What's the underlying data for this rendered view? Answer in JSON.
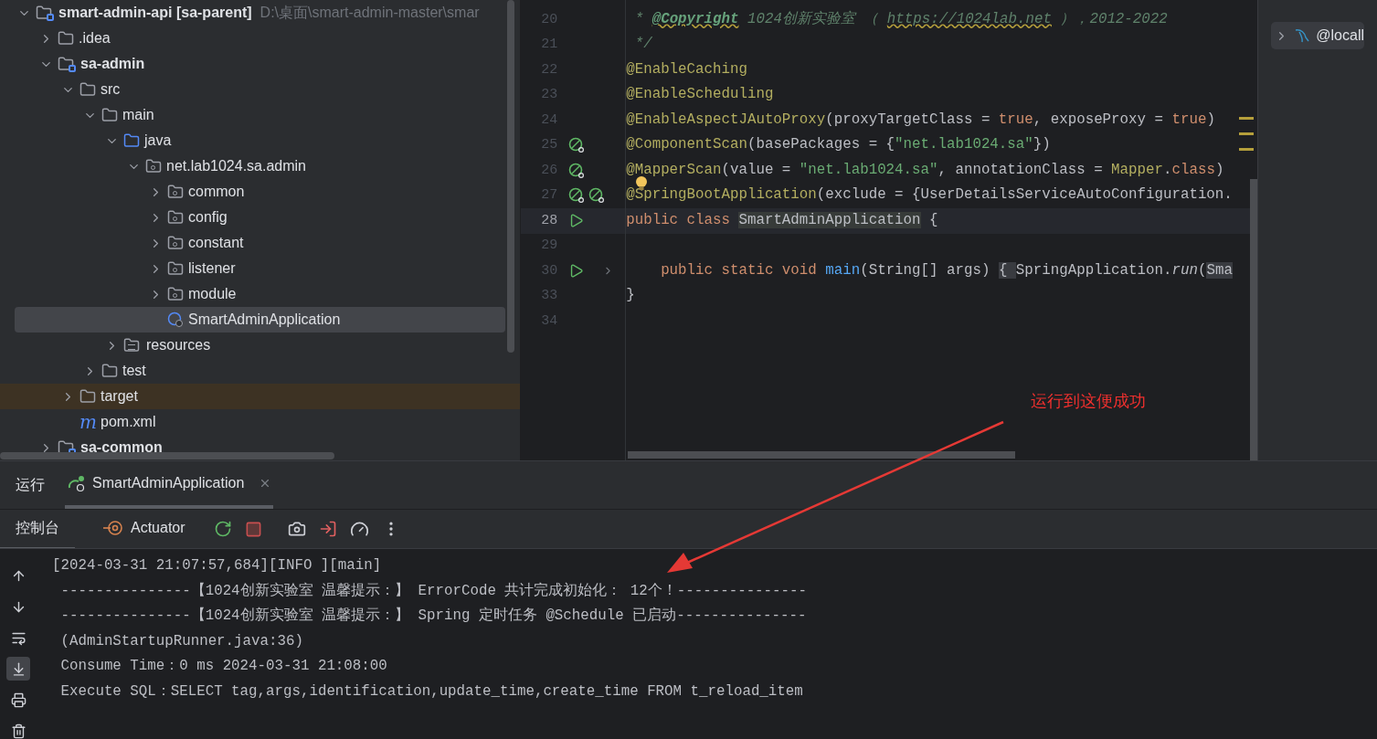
{
  "project_tree": [
    {
      "label": "smart-admin-api [sa-parent]",
      "path": "D:\\桌面\\smart-admin-master\\smar",
      "kind": "module",
      "expanded": true,
      "selected": false,
      "excluded": false,
      "children": [
        {
          "label": ".idea",
          "kind": "folder",
          "expanded": false,
          "selected": false,
          "excluded": false
        },
        {
          "label": "sa-admin",
          "kind": "module",
          "expanded": true,
          "selected": false,
          "excluded": false,
          "children": [
            {
              "label": "src",
              "kind": "folder",
              "expanded": true,
              "selected": false,
              "excluded": false,
              "children": [
                {
                  "label": "main",
                  "kind": "folder",
                  "expanded": true,
                  "selected": false,
                  "excluded": false,
                  "children": [
                    {
                      "label": "java",
                      "kind": "source",
                      "expanded": true,
                      "selected": false,
                      "excluded": false,
                      "children": [
                        {
                          "label": "net.lab1024.sa.admin",
                          "kind": "package",
                          "expanded": true,
                          "selected": false,
                          "excluded": false,
                          "children": [
                            {
                              "label": "common",
                              "kind": "package",
                              "expanded": false,
                              "selected": false,
                              "excluded": false
                            },
                            {
                              "label": "config",
                              "kind": "package",
                              "expanded": false,
                              "selected": false,
                              "excluded": false
                            },
                            {
                              "label": "constant",
                              "kind": "package",
                              "expanded": false,
                              "selected": false,
                              "excluded": false
                            },
                            {
                              "label": "listener",
                              "kind": "package",
                              "expanded": false,
                              "selected": false,
                              "excluded": false
                            },
                            {
                              "label": "module",
                              "kind": "package",
                              "expanded": false,
                              "selected": false,
                              "excluded": false
                            },
                            {
                              "label": "SmartAdminApplication",
                              "kind": "class",
                              "selected": true,
                              "excluded": false
                            }
                          ]
                        }
                      ]
                    },
                    {
                      "label": "resources",
                      "kind": "resources",
                      "expanded": false,
                      "selected": false,
                      "excluded": false
                    }
                  ]
                },
                {
                  "label": "test",
                  "kind": "folder",
                  "expanded": false,
                  "selected": false,
                  "excluded": false
                }
              ]
            },
            {
              "label": "target",
              "kind": "folder",
              "expanded": false,
              "selected": false,
              "excluded": true
            },
            {
              "label": "pom.xml",
              "kind": "maven",
              "icon_glyph": "m",
              "selected": false,
              "excluded": false
            }
          ]
        },
        {
          "label": "sa-common",
          "kind": "module",
          "expanded": false,
          "selected": false,
          "excluded": false
        }
      ]
    }
  ],
  "editor": {
    "lines": [
      {
        "number": "20",
        "current": false,
        "tokens": [
          {
            "text": " * ",
            "kind": "comment"
          },
          {
            "text": "@Copyright",
            "kind": "doc-tag"
          },
          {
            "text": " 1024创新实验室 （ ",
            "kind": "comment"
          },
          {
            "text": "https://1024lab.net",
            "kind": "doc-link"
          },
          {
            "text": " ），2012-2022",
            "kind": "comment"
          }
        ]
      },
      {
        "number": "21",
        "current": false,
        "tokens": [
          {
            "text": " */",
            "kind": "comment"
          }
        ]
      },
      {
        "number": "22",
        "current": false,
        "tokens": [
          {
            "text": "@EnableCaching",
            "kind": "annotation"
          }
        ]
      },
      {
        "number": "23",
        "current": false,
        "tokens": [
          {
            "text": "@EnableScheduling",
            "kind": "annotation"
          }
        ]
      },
      {
        "number": "24",
        "current": false,
        "tokens": [
          {
            "text": "@EnableAspectJAutoProxy",
            "kind": "annotation"
          },
          {
            "text": "(proxyTargetClass = ",
            "kind": "plain"
          },
          {
            "text": "true",
            "kind": "keyword"
          },
          {
            "text": ", exposeProxy = ",
            "kind": "plain"
          },
          {
            "text": "true",
            "kind": "keyword"
          },
          {
            "text": ")",
            "kind": "plain"
          }
        ]
      },
      {
        "number": "25",
        "current": false,
        "gutter": [
          {
            "kind": "bean"
          }
        ],
        "tokens": [
          {
            "text": "@ComponentScan",
            "kind": "annotation"
          },
          {
            "text": "(basePackages = {",
            "kind": "plain"
          },
          {
            "text": "\"net.lab1024.sa\"",
            "kind": "string"
          },
          {
            "text": "})",
            "kind": "plain"
          }
        ]
      },
      {
        "number": "26",
        "current": false,
        "gutter": [
          {
            "kind": "bean"
          }
        ],
        "tokens": [
          {
            "text": "@MapperScan",
            "kind": "annotation"
          },
          {
            "text": "(value = ",
            "kind": "plain"
          },
          {
            "text": "\"net.lab1024.sa\"",
            "kind": "string"
          },
          {
            "text": ", annotationClass = ",
            "kind": "plain"
          },
          {
            "text": "Mapper",
            "kind": "annotation"
          },
          {
            "text": ".",
            "kind": "plain"
          },
          {
            "text": "class",
            "kind": "keyword"
          },
          {
            "text": ")",
            "kind": "plain"
          }
        ]
      },
      {
        "number": "27",
        "current": false,
        "gutter": [
          {
            "kind": "bean"
          },
          {
            "kind": "bean"
          }
        ],
        "bulb": true,
        "tokens": [
          {
            "text": "@SpringBootApplication",
            "kind": "annotation"
          },
          {
            "text": "(exclude = {UserDetailsServiceAutoConfiguration.",
            "kind": "plain"
          }
        ]
      },
      {
        "number": "28",
        "current": true,
        "gutter": [
          {
            "kind": "run"
          }
        ],
        "tokens": [
          {
            "text": "public class ",
            "kind": "keyword"
          },
          {
            "text": "SmartAdminApplication",
            "kind": "usage"
          },
          {
            "text": " {",
            "kind": "plain"
          }
        ]
      },
      {
        "number": "29",
        "current": false
      },
      {
        "number": "30",
        "current": false,
        "gutter": [
          {
            "kind": "run"
          },
          {
            "kind": "fold"
          }
        ],
        "tokens": [
          {
            "text": "    public static void ",
            "kind": "keyword"
          },
          {
            "text": "main",
            "kind": "method"
          },
          {
            "text": "(String[] args) ",
            "kind": "plain"
          },
          {
            "text": "{ ",
            "kind": "folded"
          },
          {
            "text": "SpringApplication.",
            "kind": "plain"
          },
          {
            "text": "run",
            "kind": "static"
          },
          {
            "text": "(",
            "kind": "plain"
          },
          {
            "text": "Sma",
            "kind": "folded"
          }
        ]
      },
      {
        "number": "33",
        "current": false,
        "tokens": [
          {
            "text": "}",
            "kind": "plain"
          }
        ]
      },
      {
        "number": "34",
        "current": false
      }
    ]
  },
  "database_panel": {
    "items": [
      {
        "label": "@locall",
        "expanded": false
      }
    ]
  },
  "annotation": {
    "text": "运行到这便成功"
  },
  "run_panel": {
    "title": "运行",
    "tabs": [
      {
        "label": "SmartAdminApplication",
        "selected": true
      }
    ],
    "toolbar": {
      "tabs": [
        {
          "label": "控制台",
          "kind": "console",
          "selected": true
        },
        {
          "label": "Actuator",
          "kind": "actuator",
          "selected": false
        }
      ],
      "actions": [
        {
          "kind": "rerun"
        },
        {
          "kind": "stop"
        },
        {
          "kind": "camera"
        },
        {
          "kind": "exit"
        },
        {
          "kind": "gauge"
        },
        {
          "kind": "more"
        }
      ]
    },
    "side_tools": [
      {
        "kind": "up",
        "on": false
      },
      {
        "kind": "down",
        "on": false
      },
      {
        "kind": "wrap",
        "on": false
      },
      {
        "kind": "scroll-end",
        "on": true
      },
      {
        "kind": "print",
        "on": false
      },
      {
        "kind": "trash",
        "on": false
      }
    ],
    "console": [
      "[2024-03-31 21:07:57,684][INFO ][main]",
      " ---------------【1024创新实验室 温馨提示：】 ErrorCode 共计完成初始化： 12个！---------------",
      " ---------------【1024创新实验室 温馨提示：】 Spring 定时任务 @Schedule 已启动---------------",
      " (AdminStartupRunner.java:36)",
      " Consume Time：0 ms 2024-03-31 21:08:00",
      " Execute SQL：SELECT tag,args,identification,update_time,create_time FROM t_reload_item"
    ]
  }
}
